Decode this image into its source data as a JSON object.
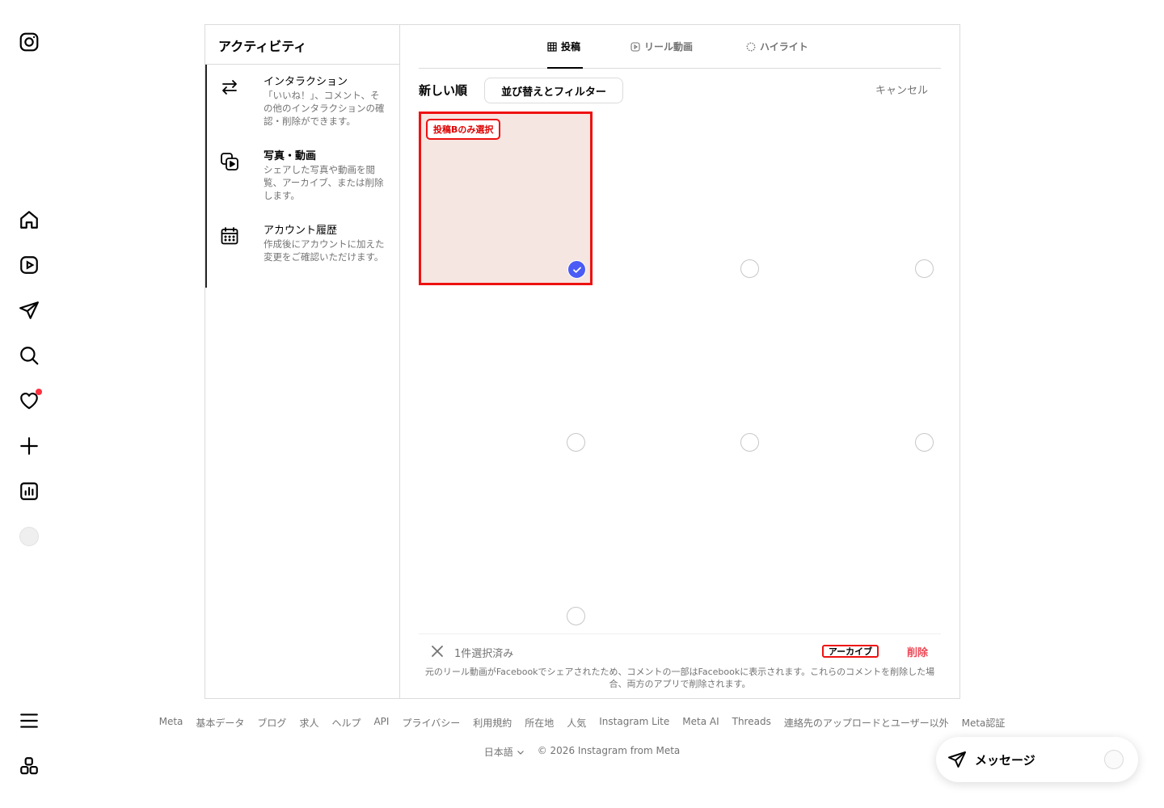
{
  "colors": {
    "accent_blue": "#4a5cf5",
    "danger": "#ed4956",
    "annotation_red": "#e11111",
    "selected_tile_bg": "#f6e6e1",
    "notification": "#ff3040"
  },
  "rail": {
    "icons": [
      "instagram-logo-icon",
      "home-icon",
      "reels-icon",
      "direct-icon",
      "search-icon",
      "heart-icon",
      "create-icon",
      "insights-icon",
      "avatar",
      "menu-icon",
      "apps-icon"
    ]
  },
  "sidebar": {
    "title": "アクティビティ",
    "items": [
      {
        "title": "インタラクション",
        "desc": "「いいね！」、コメント、その他のインタラクションの確認・削除ができます。",
        "icon": "interactions-icon"
      },
      {
        "title": "写真・動画",
        "desc": "シェアした写真や動画を閲覧、アーカイブ、または削除します。",
        "icon": "photos-videos-icon"
      },
      {
        "title": "アカウント履歴",
        "desc": "作成後にアカウントに加えた変更をご確認いただけます。",
        "icon": "calendar-icon"
      }
    ]
  },
  "tabs": [
    {
      "label": "投稿",
      "active": true,
      "icon": "grid-icon"
    },
    {
      "label": "リール動画",
      "active": false,
      "icon": "reels-icon"
    },
    {
      "label": "ハイライト",
      "active": false,
      "icon": "highlights-icon"
    }
  ],
  "toolbar": {
    "sort_label": "新しい順",
    "filter_button": "並び替えとフィルター",
    "cancel": "キャンセル"
  },
  "grid": {
    "annotation": "投稿Bのみ選択",
    "tiles": [
      {
        "selected": true
      },
      {
        "selected": false
      },
      {
        "selected": false
      },
      {
        "selected": false
      },
      {
        "selected": false
      },
      {
        "selected": false
      },
      {
        "selected": false
      }
    ]
  },
  "bottom_bar": {
    "selected_count": "1件選択済み",
    "archive": "アーカイブ",
    "delete": "削除",
    "note": "元のリール動画がFacebookでシェアされたため、コメントの一部はFacebookに表示されます。これらのコメントを削除した場合、両方のアプリで削除されます。"
  },
  "footer": {
    "links": [
      "Meta",
      "基本データ",
      "ブログ",
      "求人",
      "ヘルプ",
      "API",
      "プライバシー",
      "利用規約",
      "所在地",
      "人気",
      "Instagram Lite",
      "Meta AI",
      "Threads",
      "連絡先のアップロードとユーザー以外",
      "Meta認証"
    ],
    "language": "日本語",
    "copyright": "© 2026 Instagram from Meta"
  },
  "messages": {
    "label": "メッセージ"
  }
}
